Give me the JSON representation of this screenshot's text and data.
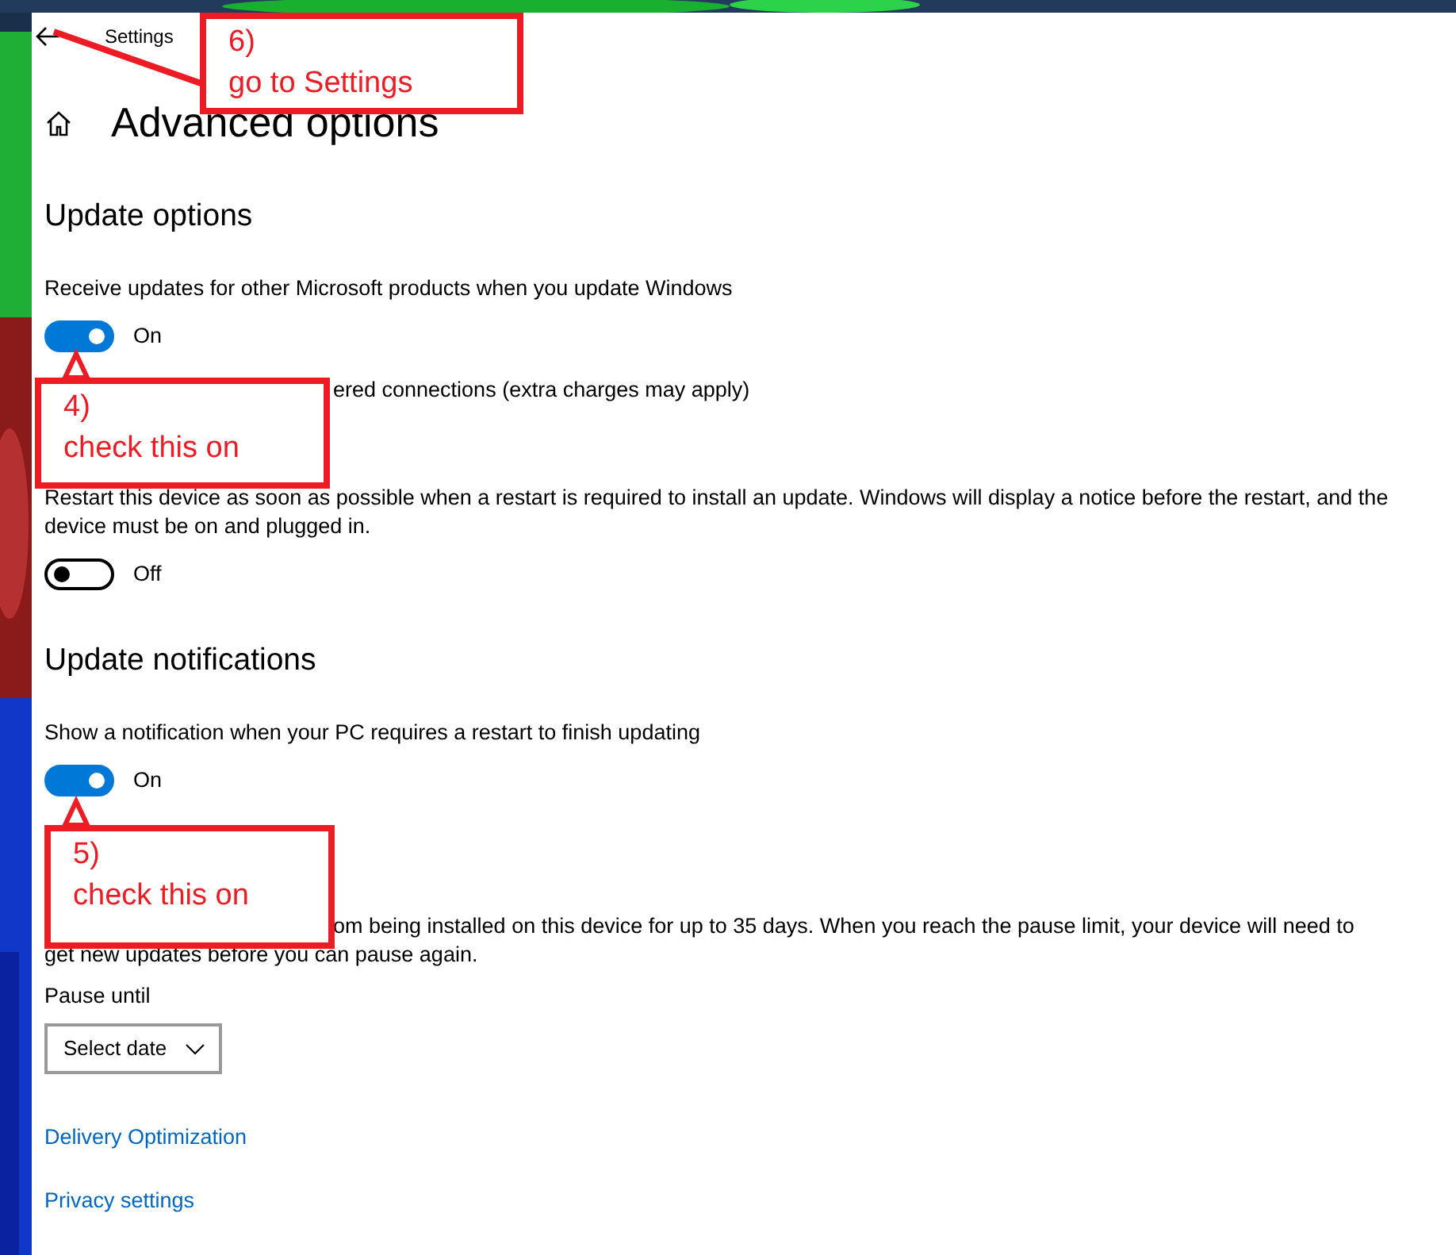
{
  "window": {
    "title": "Settings"
  },
  "page": {
    "title": "Advanced options"
  },
  "sections": [
    {
      "heading": "Update options",
      "settings": [
        {
          "kind": "toggle",
          "label": "Receive updates for other Microsoft products when you update Windows",
          "on": true,
          "state_text": "On"
        },
        {
          "kind": "partial",
          "label": "ered connections (extra charges may apply)"
        },
        {
          "kind": "toggle",
          "label": "Restart this device as soon as possible when a restart is required to install an update. Windows will display a notice before the restart, and the device must be on and plugged in.",
          "on": false,
          "state_text": "Off"
        }
      ]
    },
    {
      "heading": "Update notifications",
      "settings": [
        {
          "kind": "toggle",
          "label": "Show a notification when your PC requires a restart to finish updating",
          "on": true,
          "state_text": "On"
        }
      ]
    },
    {
      "settings": [
        {
          "kind": "partial",
          "label": "om being installed on this device for up to 35 days. When you reach the pause limit, your device will need to get new updates before you can pause again."
        },
        {
          "kind": "dropdown",
          "label": "Pause until",
          "value": "Select date"
        }
      ]
    }
  ],
  "links": [
    "Delivery Optimization",
    "Privacy settings"
  ],
  "annotations": [
    {
      "number": "6)",
      "text": "go to Settings"
    },
    {
      "number": "4)",
      "text": "check this on"
    },
    {
      "number": "5)",
      "text": "check this on"
    }
  ]
}
